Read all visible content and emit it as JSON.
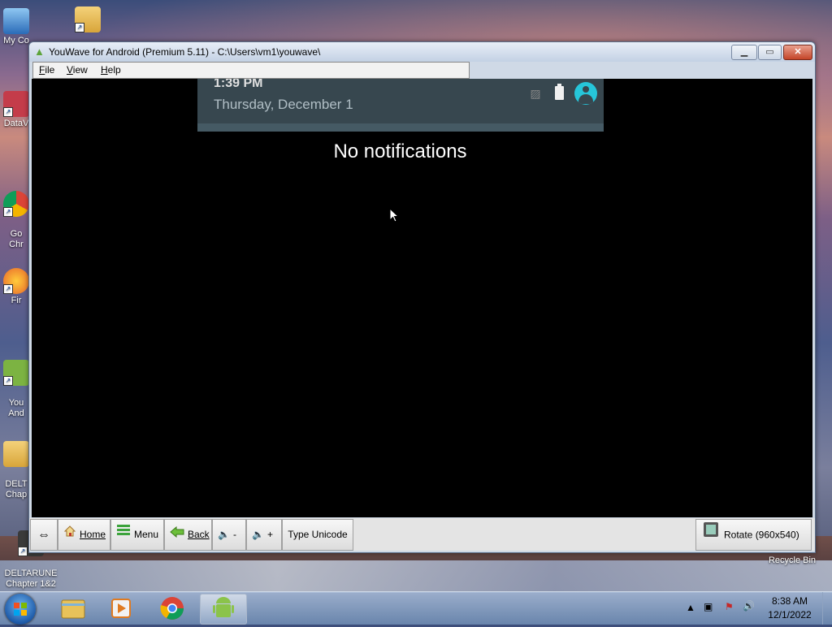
{
  "desktop": {
    "icons": [
      {
        "label": "My Co"
      },
      {
        "label": ""
      },
      {
        "label": "DataV"
      },
      {
        "label": "Go\nChr"
      },
      {
        "label": "Fir"
      },
      {
        "label": "You\nAnd"
      },
      {
        "label": "DELT\nChap"
      },
      {
        "label": "DELTARUNE\nChapter 1&2"
      },
      {
        "label": "Recycle Bin"
      }
    ]
  },
  "window": {
    "title": "YouWave for Android (Premium 5.11) - C:\\Users\\vm1\\youwave\\",
    "menu": [
      "File",
      "View",
      "Help"
    ]
  },
  "android": {
    "time": "1:39 PM",
    "date": "Thursday, December 1",
    "no_notifications": "No notifications"
  },
  "toolbar": {
    "home": "Home",
    "menu": "Menu",
    "back": "Back",
    "vol_down": "-",
    "vol_up": "+",
    "type_unicode": "Type Unicode",
    "rotate": "Rotate (960x540)"
  },
  "taskbar": {
    "time": "8:38 AM",
    "date": "12/1/2022"
  },
  "colors": {
    "accent": "#26c6da",
    "shade": "#37474f"
  }
}
